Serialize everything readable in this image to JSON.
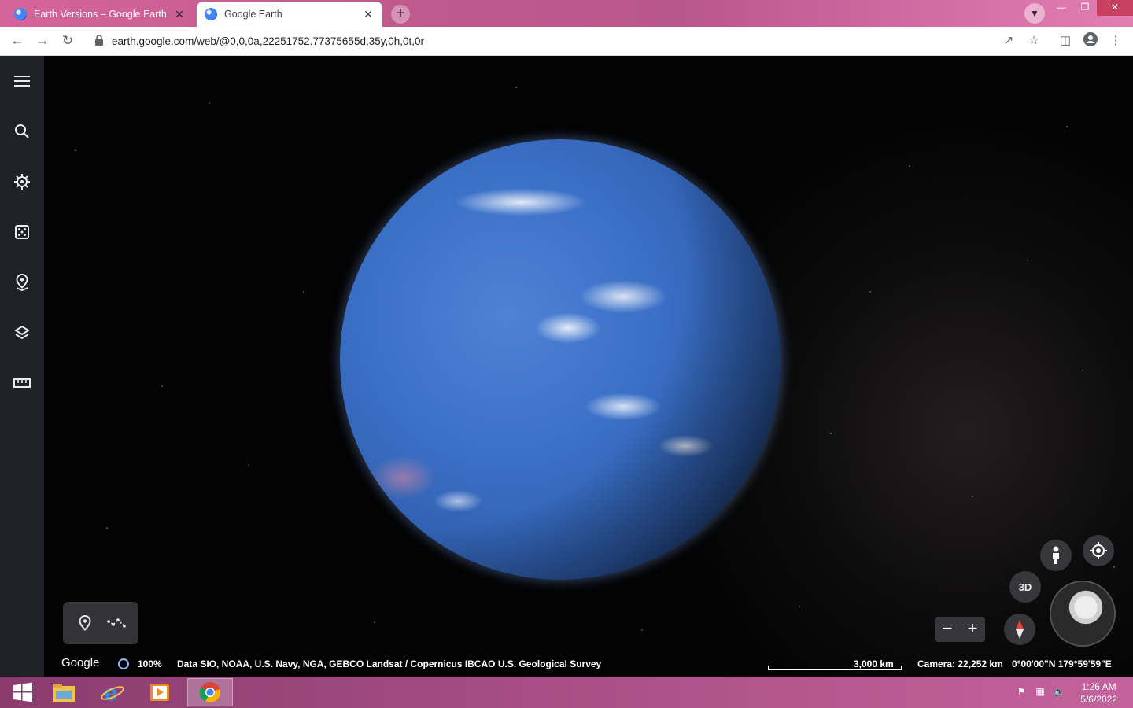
{
  "browser": {
    "tabs": [
      {
        "title": "Earth Versions – Google Earth",
        "active": false
      },
      {
        "title": "Google Earth",
        "active": true
      }
    ],
    "new_tab_label": "+",
    "close_glyph": "✕",
    "url": "earth.google.com/web/@0,0,0a,22251752.77375655d,35y,0h,0t,0r"
  },
  "earth": {
    "rail_icons": [
      "menu-icon",
      "search-icon",
      "voyager-icon",
      "feeling-lucky-icon",
      "projects-icon",
      "map-style-icon",
      "measure-icon"
    ],
    "controls": {
      "btn_3d": "3D",
      "zoom_out": "−",
      "zoom_in": "+"
    },
    "footer": {
      "logo": "Google",
      "loading": "100%",
      "attribution": "Data SIO, NOAA, U.S. Navy, NGA, GEBCO  Landsat / Copernicus  IBCAO  U.S. Geological Survey",
      "scale": "3,000 km",
      "camera": "Camera: 22,252 km",
      "coords": "0°00'00\"N 179°59'59\"E"
    }
  },
  "taskbar": {
    "apps": [
      "start-icon",
      "file-explorer-icon",
      "internet-explorer-icon",
      "media-player-icon",
      "chrome-icon"
    ],
    "time": "1:26 AM",
    "date": "5/6/2022"
  },
  "colors": {
    "rail_bg": "#202124",
    "accent_blue": "#8ab4f8",
    "compass_red": "#ea4335"
  }
}
